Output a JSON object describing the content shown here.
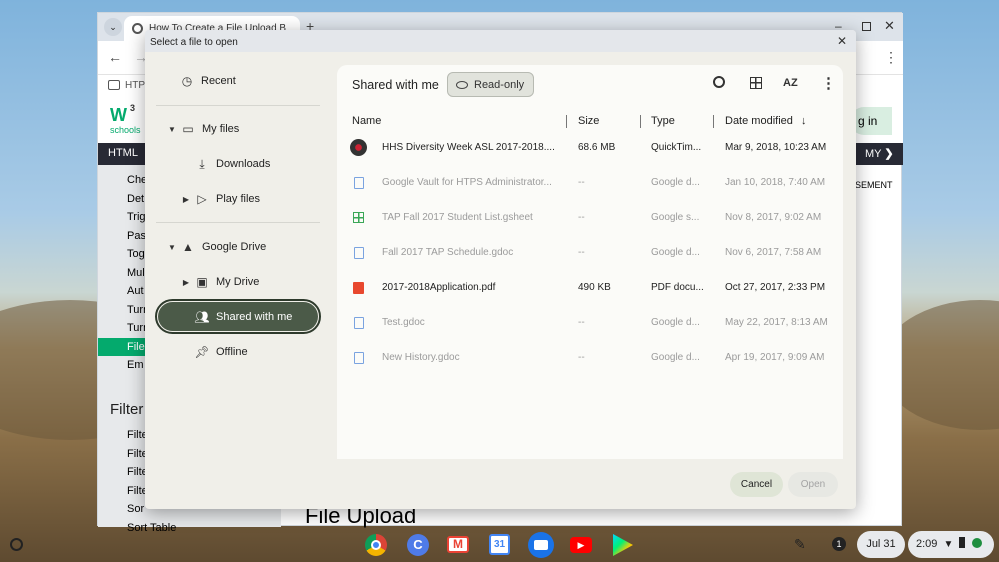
{
  "browser": {
    "tab_title": "How To Create a File Upload B",
    "bookmark_label": "HTPS",
    "w3_logo_text": "schools",
    "w3_logo_sup": "3",
    "signin_label": "g in",
    "nav_html": "HTML",
    "nav_my": "MY",
    "nav_right_text": "SEMENT",
    "sidebar_items": [
      "Che",
      "Det",
      "Trig",
      "Pas",
      "Tog",
      "Mul",
      "Aut",
      "Turn",
      "Turn",
      "File",
      "Em"
    ],
    "filter_heading": "Filter",
    "filter_items": [
      "Filte",
      "Filte",
      "Filte",
      "Filte",
      "Sor",
      "Sort Table"
    ],
    "page_heading": "File Upload"
  },
  "dialog": {
    "title": "Select a file to open",
    "nav": {
      "recent": "Recent",
      "my_files": "My files",
      "downloads": "Downloads",
      "play_files": "Play files",
      "google_drive": "Google Drive",
      "my_drive": "My Drive",
      "shared_with_me": "Shared with me",
      "offline": "Offline"
    },
    "breadcrumb": "Shared with me",
    "readonly_badge": "Read-only",
    "columns": {
      "name": "Name",
      "size": "Size",
      "type": "Type",
      "date": "Date modified"
    },
    "files": [
      {
        "name": "HHS Diversity Week ASL 2017-2018....",
        "size": "68.6 MB",
        "type": "QuickTim...",
        "date": "Mar 9, 2018, 10:23 AM",
        "icon": "video-thumbnail",
        "disabled": false
      },
      {
        "name": "Google Vault for HTPS Administrator...",
        "size": "--",
        "type": "Google d...",
        "date": "Jan 10, 2018, 7:40 AM",
        "icon": "gdoc-icon",
        "disabled": true
      },
      {
        "name": "TAP Fall 2017 Student List.gsheet",
        "size": "--",
        "type": "Google s...",
        "date": "Nov 8, 2017, 9:02 AM",
        "icon": "gsheet-icon",
        "disabled": true
      },
      {
        "name": "Fall 2017 TAP Schedule.gdoc",
        "size": "--",
        "type": "Google d...",
        "date": "Nov 6, 2017, 7:58 AM",
        "icon": "gdoc-icon",
        "disabled": true
      },
      {
        "name": "2017-2018Application.pdf",
        "size": "490 KB",
        "type": "PDF docu...",
        "date": "Oct 27, 2017, 2:33 PM",
        "icon": "pdf-icon",
        "disabled": false
      },
      {
        "name": "Test.gdoc",
        "size": "--",
        "type": "Google d...",
        "date": "May 22, 2017, 8:13 AM",
        "icon": "gdoc-icon",
        "disabled": true
      },
      {
        "name": "New History.gdoc",
        "size": "--",
        "type": "Google d...",
        "date": "Apr 19, 2017, 9:09 AM",
        "icon": "gdoc-icon",
        "disabled": true
      }
    ],
    "cancel_label": "Cancel",
    "open_label": "Open"
  },
  "shelf": {
    "date": "Jul 31",
    "time": "2:09",
    "notification_count": "1"
  },
  "colors": {
    "selected_nav": "#4b5a48",
    "w3_green": "#04aa6d",
    "cancel_bg": "#dfe5d6"
  }
}
